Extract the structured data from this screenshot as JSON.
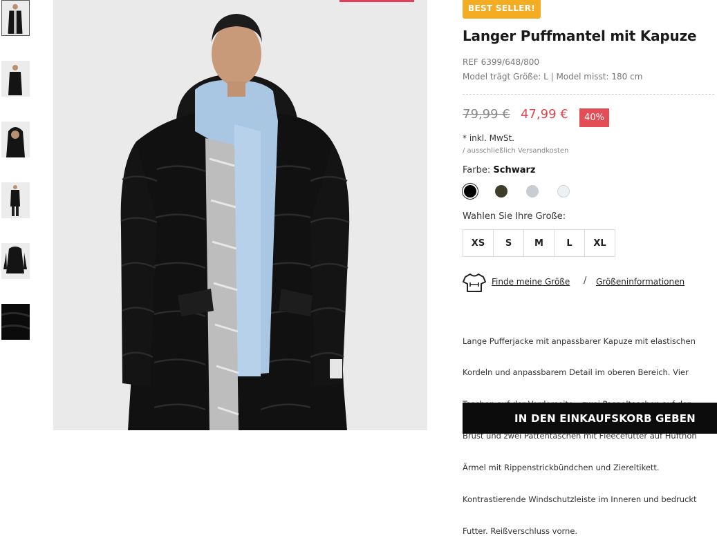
{
  "product": {
    "badge": "BEST SELLER!",
    "title": "Langer Puffmantel mit Kapuze",
    "ref": "REF 6399/648/800",
    "model_info": "Model trägt Größe: L | Model misst: 180 cm",
    "old_price": "79,99 €",
    "new_price": "47,99 €",
    "discount": "40%",
    "tax": "* inkl. MwSt.",
    "shipping": "/ ausschließlich Versandkosten",
    "color_label": "Farbe:",
    "color_value": "Schwarz",
    "colors": [
      "#000000",
      "#3d3d2a",
      "#c8ccd3",
      "#eef1f4"
    ],
    "size_label": "Wahlen Sie Ihre Große:",
    "sizes": [
      "XS",
      "S",
      "M",
      "L",
      "XL"
    ],
    "find_size_link": "Finde meine Größe",
    "size_info_link": "Größeninformationen",
    "separator": "/",
    "description_lines": [
      "Lange Pufferjacke mit anpassbarer Kapuze mit elastischen",
      "Kordeln und anpassbarem Detail im oberen Bereich. Vier",
      "Taschen auf der Vorderseite – zwei Paspeltaschen auf der",
      "Brust und zwei Pattentaschen mit Fleecefutter auf Hüfthöh",
      "Ärmel mit Rippenstrickbündchen und Ziereltikett.",
      "Kontrastierende Windschutzleiste im Inneren und bedruckt",
      "Futter. Reißverschluss vorne."
    ],
    "cart_button": "IN DEN EINKAUFSKORB GEBEN"
  },
  "icons": {
    "size_finder": "tshirt-icon"
  }
}
